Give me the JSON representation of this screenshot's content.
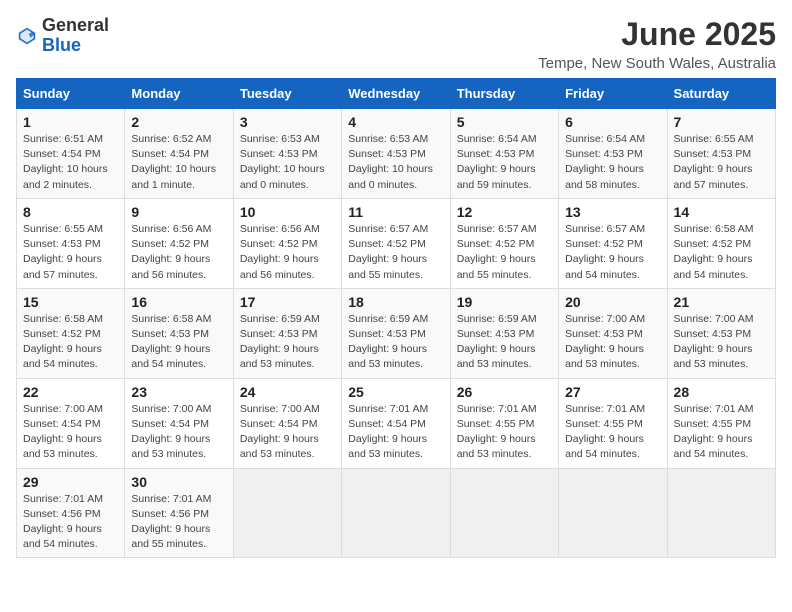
{
  "header": {
    "logo_general": "General",
    "logo_blue": "Blue",
    "title": "June 2025",
    "subtitle": "Tempe, New South Wales, Australia"
  },
  "days_of_week": [
    "Sunday",
    "Monday",
    "Tuesday",
    "Wednesday",
    "Thursday",
    "Friday",
    "Saturday"
  ],
  "weeks": [
    [
      {
        "day": "1",
        "detail": "Sunrise: 6:51 AM\nSunset: 4:54 PM\nDaylight: 10 hours\nand 2 minutes."
      },
      {
        "day": "2",
        "detail": "Sunrise: 6:52 AM\nSunset: 4:54 PM\nDaylight: 10 hours\nand 1 minute."
      },
      {
        "day": "3",
        "detail": "Sunrise: 6:53 AM\nSunset: 4:53 PM\nDaylight: 10 hours\nand 0 minutes."
      },
      {
        "day": "4",
        "detail": "Sunrise: 6:53 AM\nSunset: 4:53 PM\nDaylight: 10 hours\nand 0 minutes."
      },
      {
        "day": "5",
        "detail": "Sunrise: 6:54 AM\nSunset: 4:53 PM\nDaylight: 9 hours\nand 59 minutes."
      },
      {
        "day": "6",
        "detail": "Sunrise: 6:54 AM\nSunset: 4:53 PM\nDaylight: 9 hours\nand 58 minutes."
      },
      {
        "day": "7",
        "detail": "Sunrise: 6:55 AM\nSunset: 4:53 PM\nDaylight: 9 hours\nand 57 minutes."
      }
    ],
    [
      {
        "day": "8",
        "detail": "Sunrise: 6:55 AM\nSunset: 4:53 PM\nDaylight: 9 hours\nand 57 minutes."
      },
      {
        "day": "9",
        "detail": "Sunrise: 6:56 AM\nSunset: 4:52 PM\nDaylight: 9 hours\nand 56 minutes."
      },
      {
        "day": "10",
        "detail": "Sunrise: 6:56 AM\nSunset: 4:52 PM\nDaylight: 9 hours\nand 56 minutes."
      },
      {
        "day": "11",
        "detail": "Sunrise: 6:57 AM\nSunset: 4:52 PM\nDaylight: 9 hours\nand 55 minutes."
      },
      {
        "day": "12",
        "detail": "Sunrise: 6:57 AM\nSunset: 4:52 PM\nDaylight: 9 hours\nand 55 minutes."
      },
      {
        "day": "13",
        "detail": "Sunrise: 6:57 AM\nSunset: 4:52 PM\nDaylight: 9 hours\nand 54 minutes."
      },
      {
        "day": "14",
        "detail": "Sunrise: 6:58 AM\nSunset: 4:52 PM\nDaylight: 9 hours\nand 54 minutes."
      }
    ],
    [
      {
        "day": "15",
        "detail": "Sunrise: 6:58 AM\nSunset: 4:52 PM\nDaylight: 9 hours\nand 54 minutes."
      },
      {
        "day": "16",
        "detail": "Sunrise: 6:58 AM\nSunset: 4:53 PM\nDaylight: 9 hours\nand 54 minutes."
      },
      {
        "day": "17",
        "detail": "Sunrise: 6:59 AM\nSunset: 4:53 PM\nDaylight: 9 hours\nand 53 minutes."
      },
      {
        "day": "18",
        "detail": "Sunrise: 6:59 AM\nSunset: 4:53 PM\nDaylight: 9 hours\nand 53 minutes."
      },
      {
        "day": "19",
        "detail": "Sunrise: 6:59 AM\nSunset: 4:53 PM\nDaylight: 9 hours\nand 53 minutes."
      },
      {
        "day": "20",
        "detail": "Sunrise: 7:00 AM\nSunset: 4:53 PM\nDaylight: 9 hours\nand 53 minutes."
      },
      {
        "day": "21",
        "detail": "Sunrise: 7:00 AM\nSunset: 4:53 PM\nDaylight: 9 hours\nand 53 minutes."
      }
    ],
    [
      {
        "day": "22",
        "detail": "Sunrise: 7:00 AM\nSunset: 4:54 PM\nDaylight: 9 hours\nand 53 minutes."
      },
      {
        "day": "23",
        "detail": "Sunrise: 7:00 AM\nSunset: 4:54 PM\nDaylight: 9 hours\nand 53 minutes."
      },
      {
        "day": "24",
        "detail": "Sunrise: 7:00 AM\nSunset: 4:54 PM\nDaylight: 9 hours\nand 53 minutes."
      },
      {
        "day": "25",
        "detail": "Sunrise: 7:01 AM\nSunset: 4:54 PM\nDaylight: 9 hours\nand 53 minutes."
      },
      {
        "day": "26",
        "detail": "Sunrise: 7:01 AM\nSunset: 4:55 PM\nDaylight: 9 hours\nand 53 minutes."
      },
      {
        "day": "27",
        "detail": "Sunrise: 7:01 AM\nSunset: 4:55 PM\nDaylight: 9 hours\nand 54 minutes."
      },
      {
        "day": "28",
        "detail": "Sunrise: 7:01 AM\nSunset: 4:55 PM\nDaylight: 9 hours\nand 54 minutes."
      }
    ],
    [
      {
        "day": "29",
        "detail": "Sunrise: 7:01 AM\nSunset: 4:56 PM\nDaylight: 9 hours\nand 54 minutes."
      },
      {
        "day": "30",
        "detail": "Sunrise: 7:01 AM\nSunset: 4:56 PM\nDaylight: 9 hours\nand 55 minutes."
      },
      {
        "day": "",
        "detail": ""
      },
      {
        "day": "",
        "detail": ""
      },
      {
        "day": "",
        "detail": ""
      },
      {
        "day": "",
        "detail": ""
      },
      {
        "day": "",
        "detail": ""
      }
    ]
  ]
}
